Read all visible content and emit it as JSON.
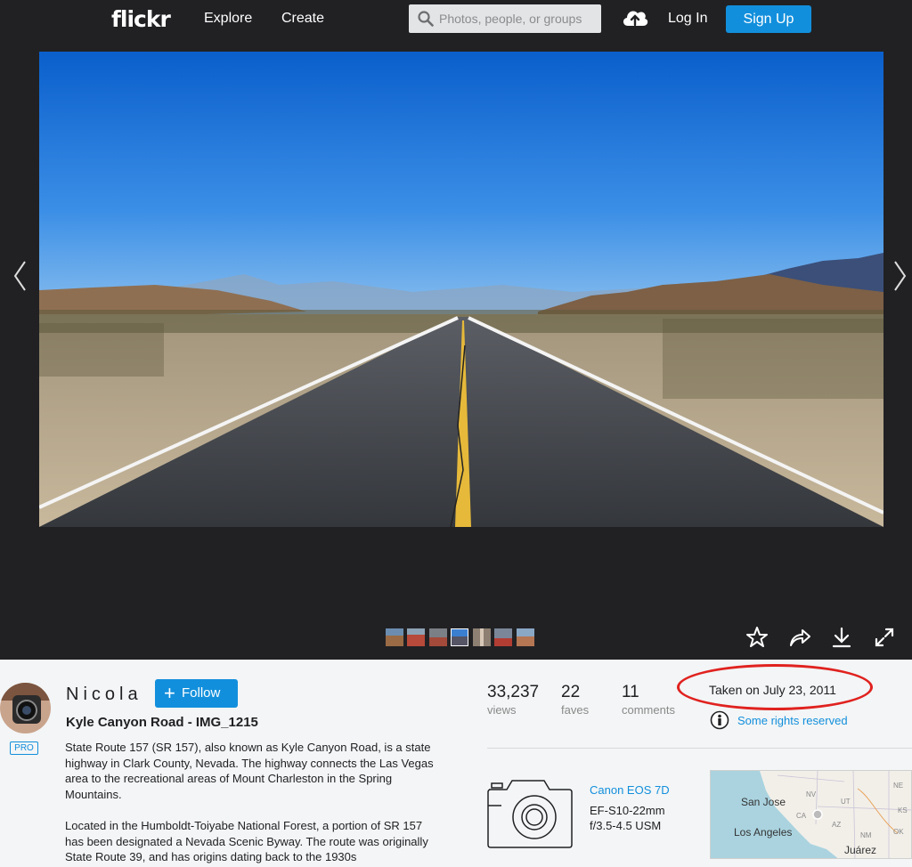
{
  "nav": {
    "logo": "flickr",
    "explore": "Explore",
    "create": "Create",
    "search_placeholder": "Photos, people, or groups",
    "login": "Log In",
    "signup": "Sign Up"
  },
  "icons": [
    "search-icon",
    "upload-cloud-icon",
    "chevron-left-icon",
    "chevron-right-icon",
    "star-icon",
    "share-icon",
    "download-icon",
    "fullscreen-icon",
    "camera-icon",
    "creative-commons-icon"
  ],
  "colors": {
    "nav_bg": "#212124",
    "accent": "#128fdc",
    "annotation": "#e0221f",
    "info_bg": "#f3f5f6"
  },
  "owner": {
    "name": "Nicola",
    "badge": "PRO",
    "follow_label": "Follow"
  },
  "photo": {
    "title": "Kyle Canyon Road - IMG_1215",
    "description_1": "State Route 157 (SR 157), also known as Kyle Canyon Road, is a state highway in Clark County, Nevada. The highway connects the Las Vegas area to the recreational areas of Mount Charleston in the Spring Mountains.",
    "description_2": "Located in the Humboldt-Toiyabe National Forest, a portion of SR 157 has been designated a Nevada Scenic Byway. The route was originally State Route 39, and has origins dating back to the 1930s"
  },
  "stats": {
    "views": {
      "value": "33,237",
      "label": "views"
    },
    "faves": {
      "value": "22",
      "label": "faves"
    },
    "comments": {
      "value": "11",
      "label": "comments"
    }
  },
  "taken": "Taken on July 23, 2011",
  "rights": "Some rights reserved",
  "camera": {
    "model": "Canon EOS 7D",
    "lens_1": "EF-S10-22mm",
    "lens_2": "f/3.5-4.5 USM"
  },
  "map": {
    "city_1": "San Jose",
    "city_2": "Los Angeles",
    "city_3": "Juárez",
    "states": [
      "NV",
      "UT",
      "CA",
      "AZ",
      "NM",
      "NE",
      "KS",
      "OK"
    ]
  }
}
